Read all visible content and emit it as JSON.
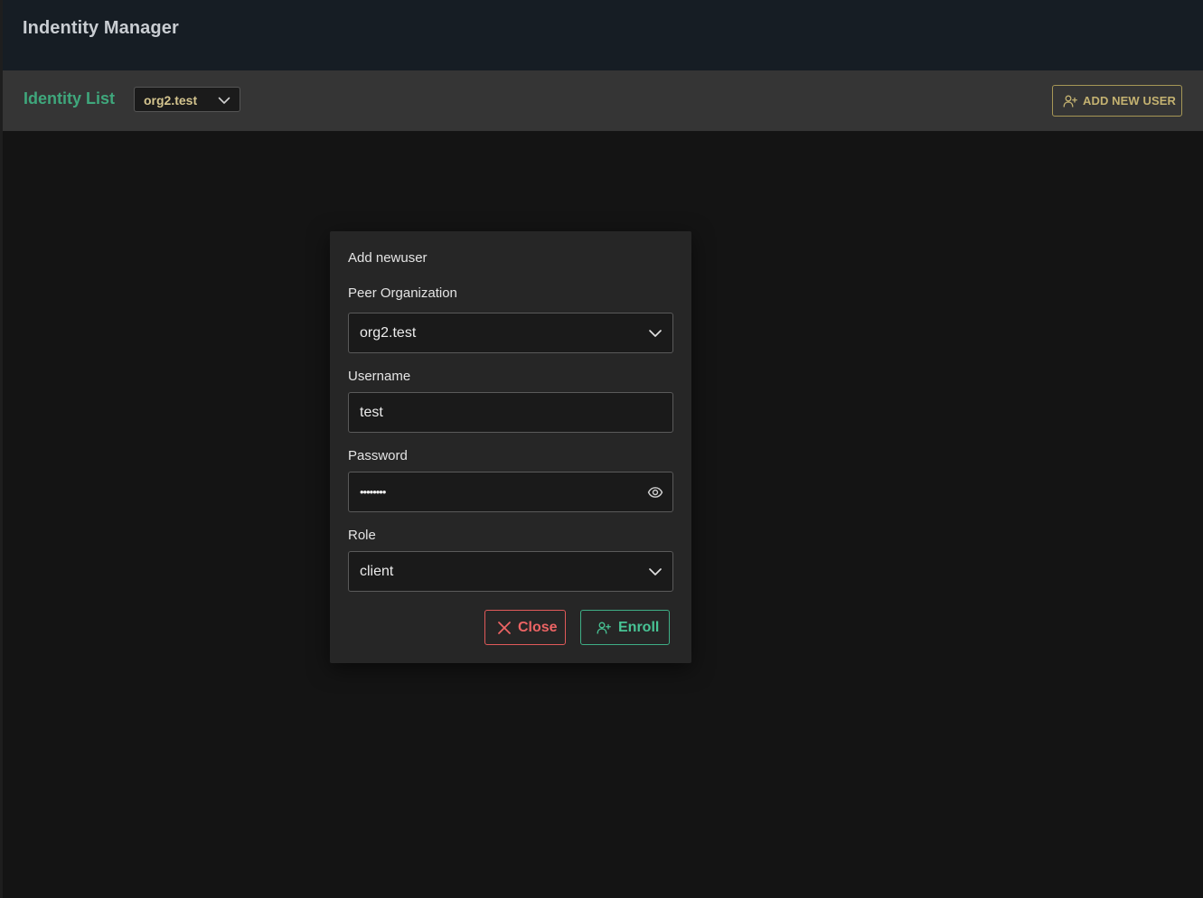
{
  "header": {
    "title": "Indentity Manager"
  },
  "toolbar": {
    "list_title": "Identity List",
    "org_selector": {
      "value": "org2.test",
      "icon": "chevron-down-icon"
    },
    "add_user_button": {
      "label": "ADD NEW USER",
      "icon": "person-add-icon"
    }
  },
  "dialog": {
    "title": "Add newuser",
    "fields": {
      "peer_org": {
        "label": "Peer Organization",
        "value": "org2.test",
        "icon": "chevron-down-icon"
      },
      "username": {
        "label": "Username",
        "value": "test"
      },
      "password": {
        "label": "Password",
        "value": "••••••••",
        "icon": "eye-icon"
      },
      "role": {
        "label": "Role",
        "value": "client",
        "icon": "chevron-down-icon"
      }
    },
    "buttons": {
      "close": {
        "label": "Close",
        "icon": "close-icon"
      },
      "enroll": {
        "label": "Enroll",
        "icon": "person-add-icon"
      }
    }
  },
  "colors": {
    "accent_green": "#3fa77c",
    "accent_gold": "#c4b271",
    "danger": "#ec6464",
    "success": "#48c495",
    "background": "#141414",
    "topbar": "#161d24",
    "subbar": "#353535",
    "dialog": "#262626"
  }
}
